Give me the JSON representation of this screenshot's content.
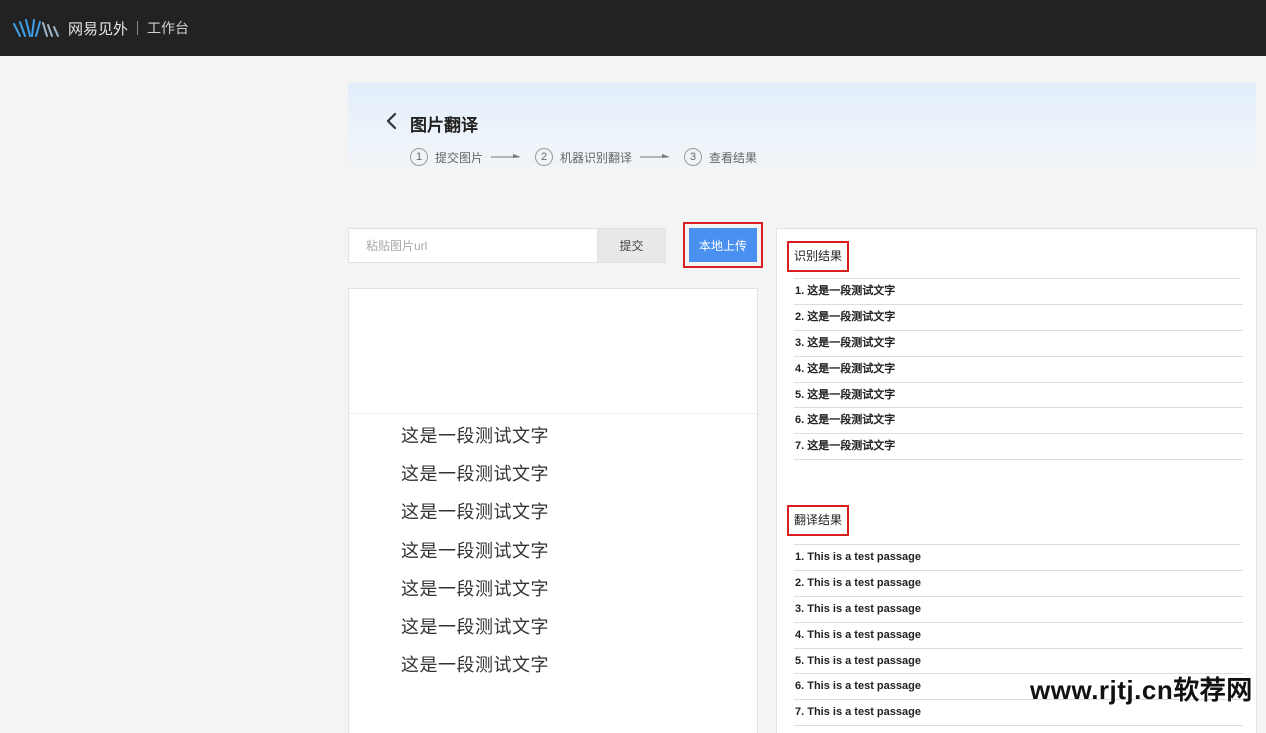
{
  "header": {
    "brand": "网易见外",
    "workspace": "工作台"
  },
  "banner": {
    "title": "图片翻译",
    "steps": [
      {
        "num": "1",
        "label": "提交图片"
      },
      {
        "num": "2",
        "label": "机器识别翻译"
      },
      {
        "num": "3",
        "label": "查看结果"
      }
    ]
  },
  "toolbar": {
    "url_placeholder": "粘贴图片url",
    "submit_label": "提交",
    "upload_label": "本地上传"
  },
  "preview": {
    "lines": [
      "这是一段测试文字",
      "这是一段测试文字",
      "这是一段测试文字",
      "这是一段测试文字",
      "这是一段测试文字",
      "这是一段测试文字",
      "这是一段测试文字"
    ]
  },
  "recognition": {
    "title": "识别结果",
    "items": [
      "1. 这是一段测试文字",
      "2. 这是一段测试文字",
      "3. 这是一段测试文字",
      "4. 这是一段测试文字",
      "5. 这是一段测试文字",
      "6. 这是一段测试文字",
      "7. 这是一段测试文字"
    ]
  },
  "translation": {
    "title": "翻译结果",
    "items": [
      "1. This is a test passage",
      "2. This is a test passage",
      "3. This is a test passage",
      "4. This is a test passage",
      "5. This is a test passage",
      "6. This is a test passage",
      "7. This is a test passage"
    ]
  },
  "watermark": "www.rjtj.cn软荐网",
  "colors": {
    "topbar": "#222222",
    "primary": "#4a90f0",
    "highlight": "#d81e1e"
  }
}
